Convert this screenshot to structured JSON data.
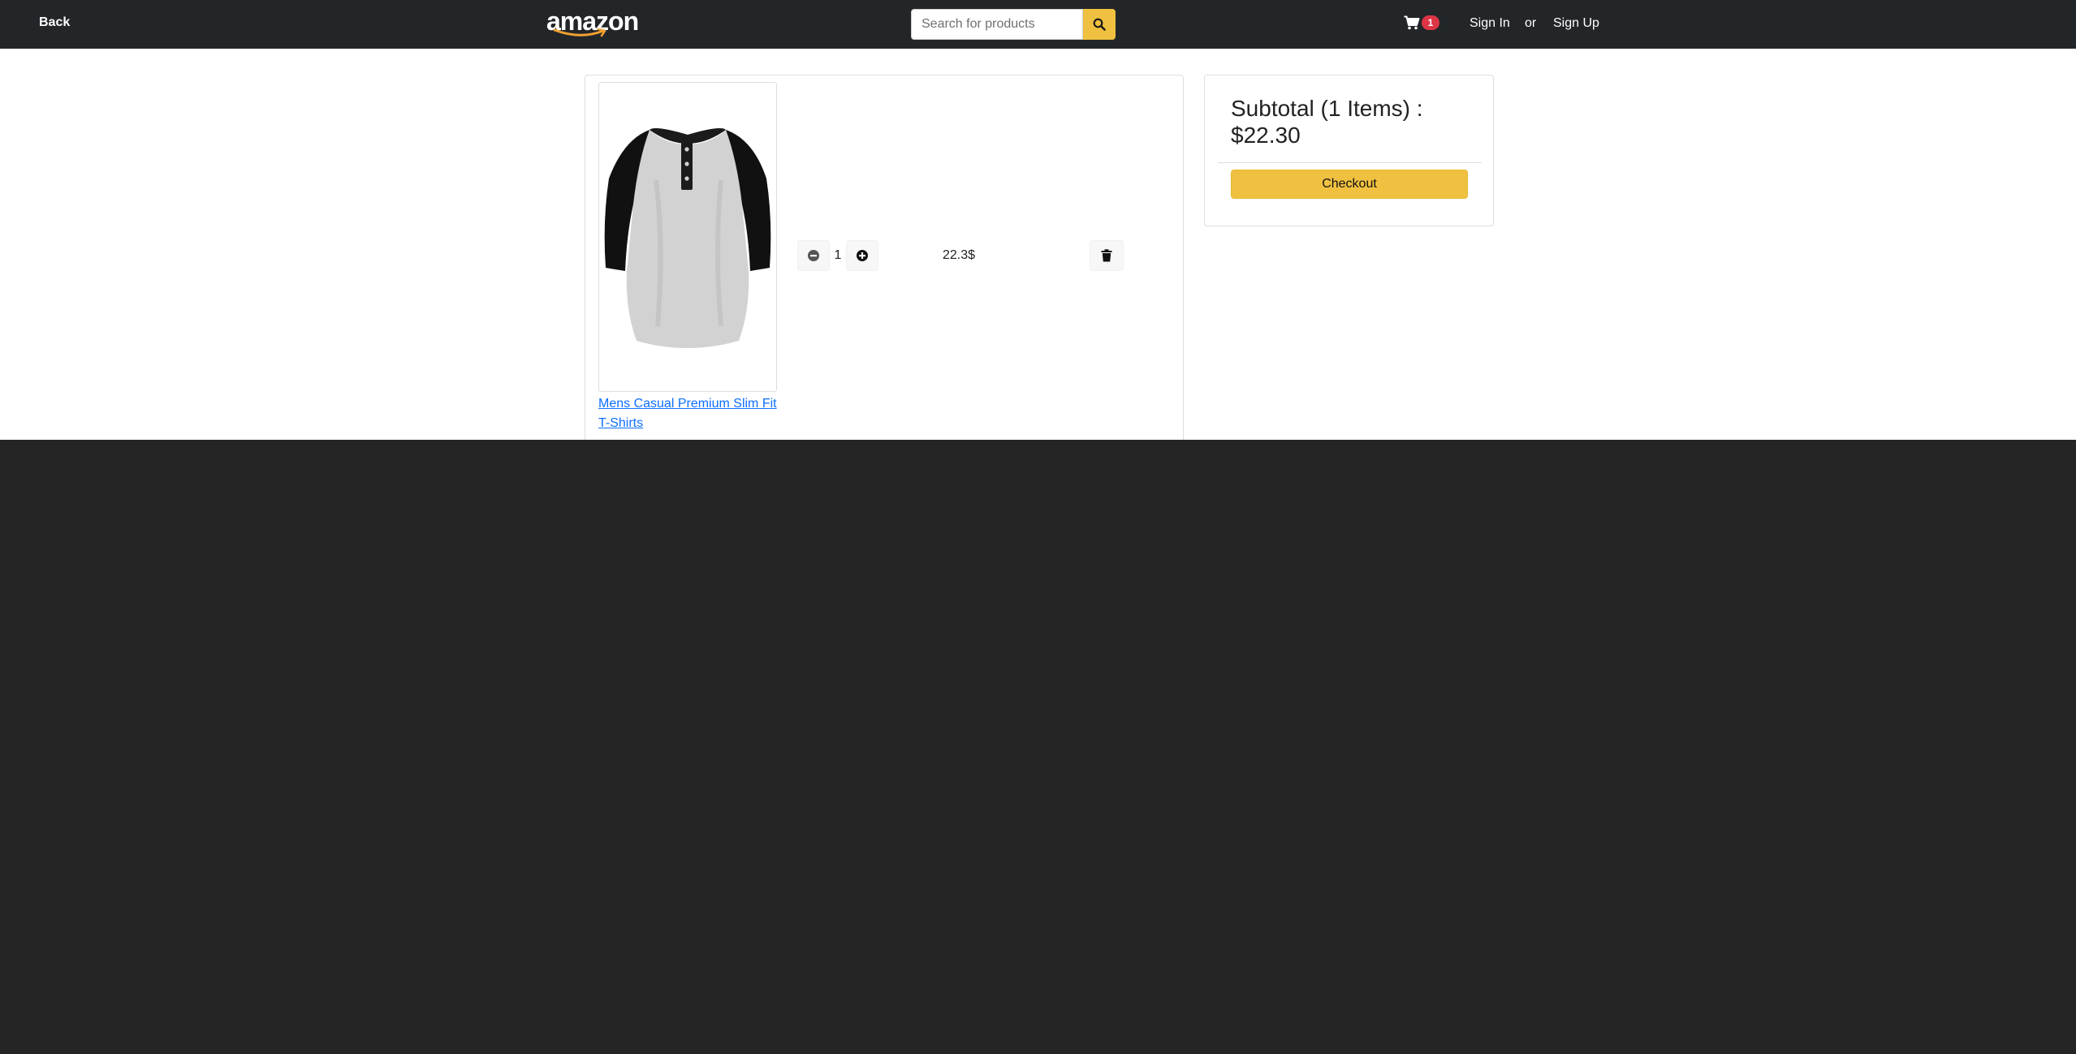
{
  "navbar": {
    "back_label": "Back",
    "logo_text": "amazon",
    "search": {
      "placeholder": "Search for products",
      "value": ""
    },
    "cart_count": "1",
    "sign_in_label": "Sign In",
    "or_text": "or",
    "sign_up_label": "Sign Up"
  },
  "cart": {
    "items": [
      {
        "name": "Mens Casual Premium Slim Fit T-Shirts",
        "quantity": "1",
        "price": "22.3$"
      }
    ]
  },
  "summary": {
    "subtotal_text": "Subtotal (1 Items) : $22.30",
    "checkout_label": "Checkout"
  },
  "colors": {
    "navbar_bg": "#232629",
    "page_bg": "#252525",
    "accent_yellow": "#f0c040",
    "badge_red": "#dc3545",
    "link_blue": "#0d6efd"
  },
  "icons": {
    "search": "search-icon",
    "cart": "cart-icon",
    "minus": "minus-circle-icon",
    "plus": "plus-circle-icon",
    "delete": "trash-icon"
  }
}
